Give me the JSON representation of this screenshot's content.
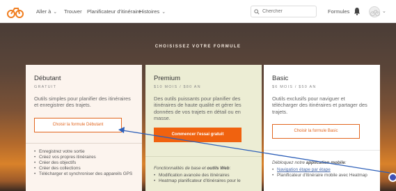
{
  "nav": {
    "logo": "bike-logo-icon",
    "items": [
      {
        "label": "Aller à",
        "has_dropdown": true
      },
      {
        "label": "Trouver",
        "has_dropdown": false
      },
      {
        "label": "Planificateur d'itinéraire",
        "has_dropdown": false
      },
      {
        "label": "Histoires",
        "has_dropdown": true
      }
    ],
    "search_placeholder": "Chercher",
    "formules": "Formules"
  },
  "hero": {
    "heading": "CHOISISSEZ VOTRE FORMULE"
  },
  "plans": {
    "debutant": {
      "name": "Débutant",
      "price": "GRATUIT",
      "description": "Outils simples pour planifier des itinéraires et enregistrer des trajets.",
      "cta": "Choisir la formule Débutant",
      "features": [
        "Enregistrez votre sortie",
        "Créez vos propres itinéraires",
        "Créer des objectifs",
        "Créer des collections",
        "Télécharger et synchroniser des appareils GPS"
      ]
    },
    "premium": {
      "name": "Premium",
      "price": "$10 MOIS / $80 AN",
      "description": "Des outils puissants pour planifier des itinéraires de haute qualité et gérer les données de vos trajets en détail ou en masse.",
      "cta": "Commencer l'essai gratuit",
      "features_intro_prefix": "Fonctionnalités de base et",
      "features_intro_bold": "outils Web",
      "features_intro_suffix": ":",
      "features": [
        "Modification avancée des itinéraires",
        "Heatmap planificateur d'itinéraires pour le"
      ]
    },
    "basic": {
      "name": "Basic",
      "price": "$6 MOIS / $50 AN",
      "description": "Outils exclusifs pour naviguer et télécharger des itinéraires et partager des trajets.",
      "cta": "Choisir la formule Basic",
      "features_intro_prefix": "Débloquez notre",
      "features_intro_bold": "application mobile",
      "features_intro_suffix": ":",
      "features": [
        "Navigation étape par étape",
        "Planificateur d'itinéraire mobile avec Heatmap"
      ]
    }
  },
  "colors": {
    "accent": "#f0620f",
    "annotation_arrow": "#2d5fb8"
  }
}
